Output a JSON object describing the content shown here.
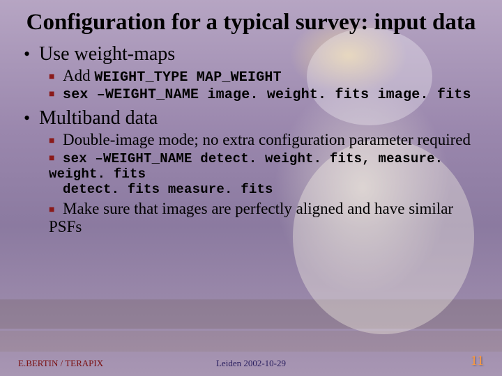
{
  "title": "Configuration for a typical survey: input data",
  "points": {
    "p1": {
      "text": "Use weight-maps"
    },
    "p1a": {
      "prefix": "Add ",
      "code": "WEIGHT_TYPE MAP_WEIGHT"
    },
    "p1b": {
      "code": "sex –WEIGHT_NAME image. weight. fits image. fits"
    },
    "p2": {
      "text": "Multiband data"
    },
    "p2a": {
      "text": "Double-image mode; no extra configuration parameter required"
    },
    "p2b": {
      "code_line1": "sex –WEIGHT_NAME detect. weight. fits, measure. weight. fits",
      "code_line2": "detect. fits measure. fits"
    },
    "p2c": {
      "text": "Make sure that images are perfectly aligned and have similar PSFs"
    }
  },
  "footer": {
    "left": "E.BERTIN / TERAPIX",
    "center": "Leiden 2002-10-29",
    "right": "11"
  }
}
